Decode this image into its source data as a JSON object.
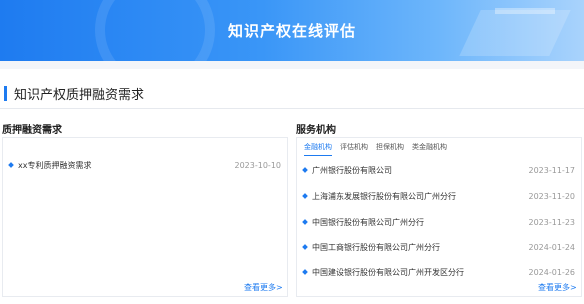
{
  "banner": {
    "title": "知识产权在线评估"
  },
  "section": {
    "title": "知识产权质押融资需求"
  },
  "left": {
    "title": "质押融资需求",
    "items": [
      {
        "text": "xx专利质押融资需求",
        "date": "2023-10-10"
      }
    ],
    "more": "查看更多>"
  },
  "right": {
    "title": "服务机构",
    "tabs": [
      "金融机构",
      "评估机构",
      "担保机构",
      "类金融机构"
    ],
    "items": [
      {
        "text": "广州银行股份有限公司",
        "date": "2023-11-17"
      },
      {
        "text": "上海浦东发展银行股份有限公司广州分行",
        "date": "2023-11-20"
      },
      {
        "text": "中国银行股份有限公司广州分行",
        "date": "2023-11-23"
      },
      {
        "text": "中国工商银行股份有限公司广州分行",
        "date": "2024-01-24"
      },
      {
        "text": "中国建设银行股份有限公司广州开发区分行",
        "date": "2024-01-26"
      }
    ],
    "more": "查看更多>"
  },
  "colors": {
    "accent": "#1e7bf0",
    "banner_start": "#1e7bf0",
    "banner_end": "#a9d3fc"
  }
}
